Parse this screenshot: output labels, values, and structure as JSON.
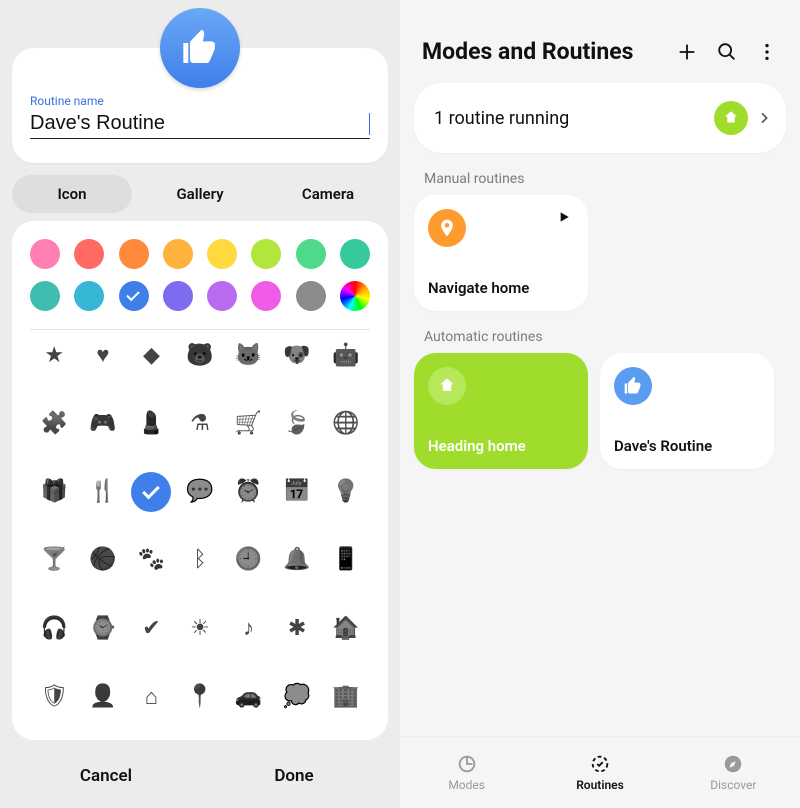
{
  "left": {
    "field_label": "Routine name",
    "routine_name": "Dave's Routine",
    "tabs": {
      "icon": "Icon",
      "gallery": "Gallery",
      "camera": "Camera"
    },
    "colors_row1": [
      "#ff7fb3",
      "#ff6b63",
      "#ff8a3d",
      "#ffb13d",
      "#ffd93d",
      "#b3e63d",
      "#4fd98a",
      "#36c99b"
    ],
    "colors_row2_pre": [
      "#3fbdb0",
      "#37b7d6"
    ],
    "colors_selected": "#3f7fe9",
    "colors_row2_post": [
      "#7d6cf0",
      "#b86cf0",
      "#f05ce6",
      "#8b8b8b"
    ],
    "color_rainbow": "rainbow",
    "icons": [
      "star",
      "heart",
      "diamond",
      "bear",
      "cat",
      "dog",
      "robot",
      "puzzle",
      "gamepad",
      "lipstick",
      "flask",
      "cart",
      "leaf",
      "globe",
      "gift",
      "utensils",
      "checkmark",
      "chat",
      "alarm",
      "calendar",
      "bulb",
      "cocktail",
      "basketball",
      "paw",
      "bluetooth",
      "clock",
      "bell",
      "phone",
      "earbuds",
      "watch",
      "check-badge",
      "sunrise",
      "music",
      "connections",
      "building-home",
      "shield",
      "person-plus",
      "house",
      "pin",
      "car",
      "comment",
      "office"
    ],
    "selected_icon_index": 16,
    "cancel": "Cancel",
    "done": "Done"
  },
  "right": {
    "title": "Modes and Routines",
    "running_text": "1 routine running",
    "manual_label": "Manual routines",
    "auto_label": "Automatic routines",
    "manual": [
      {
        "title": "Navigate home",
        "icon_bg": "#ff9a2e",
        "icon": "pin-white"
      }
    ],
    "auto": [
      {
        "title": "Heading home",
        "bg": "green",
        "icon_bg": "#b7e85a",
        "icon": "home-white"
      },
      {
        "title": "Dave's Routine",
        "bg": "white",
        "icon_bg": "#5a9df0",
        "icon": "thumbs-white"
      }
    ],
    "nav": {
      "modes": "Modes",
      "routines": "Routines",
      "discover": "Discover"
    }
  }
}
